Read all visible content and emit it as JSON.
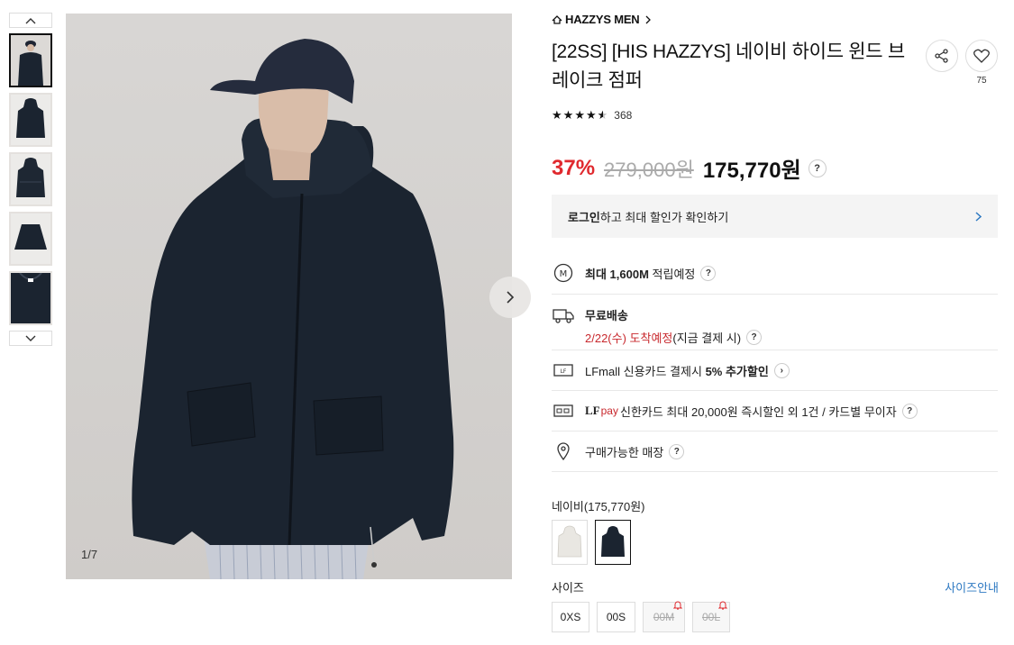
{
  "gallery": {
    "counter": "1/7",
    "thumb_count": 5
  },
  "product": {
    "brand": "HAZZYS MEN",
    "title": "[22SS] [HIS HAZZYS] 네이비 하이드 윈드 브레이크 점퍼",
    "like_count": "75",
    "review_count": "368",
    "rating": 4.5,
    "discount": "37%",
    "original_price": "279,000원",
    "final_price": "175,770원"
  },
  "login_prompt": {
    "strong": "로그인",
    "rest": "하고 최대 할인가 확인하기"
  },
  "benefits": {
    "mileage": {
      "prefix": "최대 ",
      "amount": "1,600M",
      "suffix": " 적립예정"
    },
    "shipping": {
      "title": "무료배송",
      "date": "2/22(수) 도착예정",
      "note": " (지금 결제 시)"
    },
    "card": {
      "prefix": "LFmall 신용카드 결제시 ",
      "strong": "5% 추가할인"
    },
    "lfpay": {
      "logo_lf": "LF",
      "logo_pay": "pay",
      "text": " 신한카드 최대 20,000원 즉시할인 외 1건 / 카드별 무이자"
    },
    "store": {
      "text": "구매가능한 매장"
    }
  },
  "options": {
    "color_label": "네이비(175,770원)",
    "size_label": "사이즈",
    "size_guide": "사이즈안내",
    "sizes": [
      {
        "label": "0XS",
        "soldout": false
      },
      {
        "label": "00S",
        "soldout": false
      },
      {
        "label": "00M",
        "soldout": true
      },
      {
        "label": "00L",
        "soldout": true
      }
    ]
  },
  "colors": {
    "accent_red": "#e0292e",
    "link_blue": "#2e79c2",
    "jacket_navy": "#1b2430"
  }
}
